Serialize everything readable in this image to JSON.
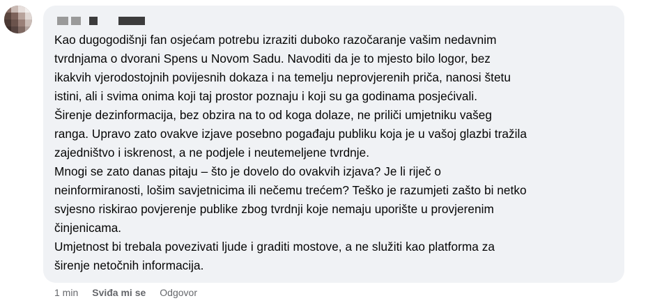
{
  "comment": {
    "text": "Kao dugogodišnji fan osjećam potrebu izraziti duboko razočaranje vašim nedavnim\ntvrdnjama o dvorani Spens u Novom Sadu. Navoditi da je to mjesto bilo logor, bez\nikakvih vjerodostojnih povijesnih dokaza i na temelju neprovjerenih priča, nanosi štetu\nistini, ali i svima onima koji taj prostor poznaju i koji su ga godinama posjećivali.\nŠirenje dezinformacija, bez obzira na to od koga dolaze, ne priliči umjetniku vašeg\nranga. Upravo zato ovakve izjave posebno pogađaju publiku koja je u vašoj glazbi tražila\nzajedništvo i iskrenost, a ne podjele i neutemeljene tvrdnje.\nMnogi se zato danas pitaju – što je dovelo do ovakvih izjava? Je li riječ o\nneinformiranosti, lošim savjetnicima ili nečemu trećem? Teško je razumjeti zašto bi netko\nsvjesno riskirao povjerenje publike zbog tvrdnji koje nemaju uporište u provjerenim\nčinjenicama.\nUmjetnost bi trebala povezivati ljude i graditi mostove, a ne služiti kao platforma za\nširenje netočnih informacija."
  },
  "actions": {
    "timestamp": "1 min",
    "like_label": "Sviđa mi se",
    "reply_label": "Odgovor"
  },
  "colors": {
    "bubble_bg": "#f0f2f5",
    "text": "#050505",
    "secondary_text": "#65676b"
  }
}
